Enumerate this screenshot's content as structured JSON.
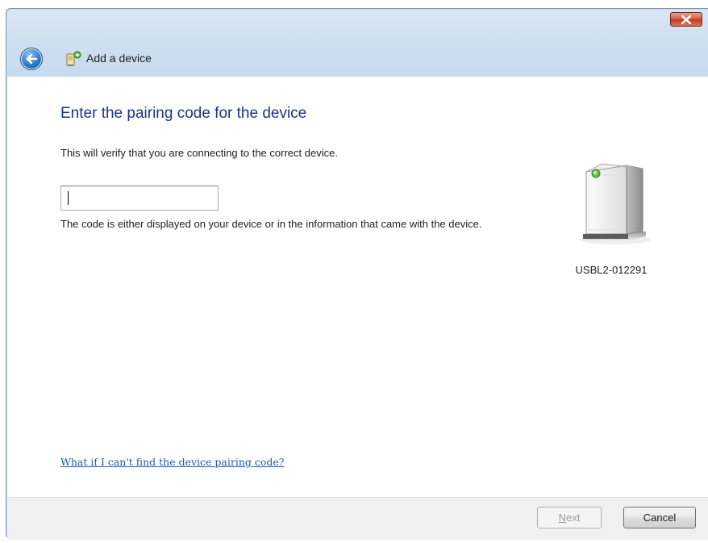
{
  "window": {
    "title": "Add a device",
    "close_icon": "close-icon",
    "back_icon": "back-arrow-icon",
    "app_icon": "add-device-icon"
  },
  "page": {
    "heading": "Enter the pairing code for the device",
    "description": "This will verify that you are connecting to the correct device.",
    "code_input_value": "",
    "hint": "The code is either displayed on your device or in the information that came with the device.",
    "help_link": "What if I can't find the device pairing code?"
  },
  "device": {
    "name": "USBL2-012291",
    "icon": "computer-tower-icon"
  },
  "footer": {
    "next_label_prefix": "",
    "next_label_accel": "N",
    "next_label_suffix": "ext",
    "cancel_label": "Cancel"
  },
  "colors": {
    "heading": "#1e3287",
    "link": "#1e58b4",
    "title_bar": "#cfdff1",
    "close_button": "#c13a1e"
  }
}
